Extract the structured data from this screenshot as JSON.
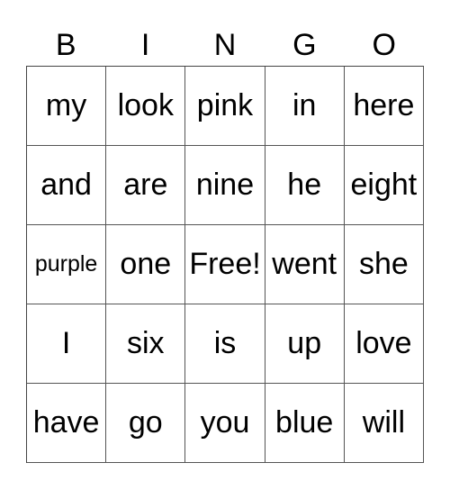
{
  "header": [
    "B",
    "I",
    "N",
    "G",
    "O"
  ],
  "cells": [
    [
      "my",
      "look",
      "pink",
      "in",
      "here"
    ],
    [
      "and",
      "are",
      "nine",
      "he",
      "eight"
    ],
    [
      "purple",
      "one",
      "Free!",
      "went",
      "she"
    ],
    [
      "I",
      "six",
      "is",
      "up",
      "love"
    ],
    [
      "have",
      "go",
      "you",
      "blue",
      "will"
    ]
  ]
}
